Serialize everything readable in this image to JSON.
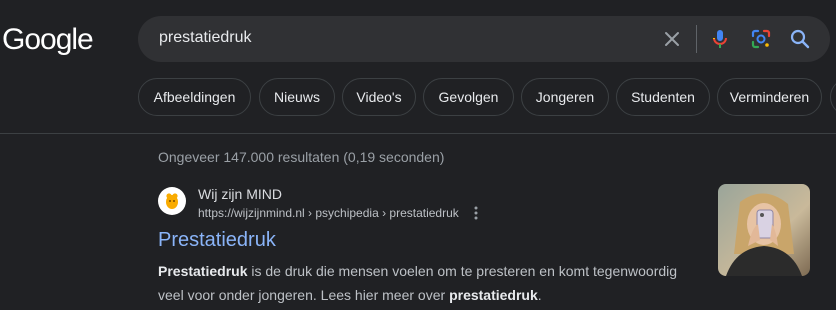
{
  "logo": {
    "text": "Google"
  },
  "search": {
    "query": "prestatiedruk"
  },
  "icons": {
    "clear": "close-icon",
    "voice": "microphone-icon",
    "lens": "camera-lens-icon",
    "search": "magnifier-icon"
  },
  "chips": [
    {
      "label": "Afbeeldingen"
    },
    {
      "label": "Nieuws"
    },
    {
      "label": "Video's"
    },
    {
      "label": "Gevolgen"
    },
    {
      "label": "Jongeren"
    },
    {
      "label": "Studenten"
    },
    {
      "label": "Verminderen"
    }
  ],
  "stats": "Ongeveer 147.000 resultaten (0,19 seconden)",
  "result": {
    "site_name": "Wij zijn MIND",
    "url": "https://wijzijnmind.nl › psychipedia › prestatiedruk",
    "title": "Prestatiedruk",
    "snippet": {
      "bold1": "Prestatiedruk",
      "text1": " is de druk die mensen voelen om te presteren en komt tegenwoordig veel voor onder jongeren. Lees hier meer over ",
      "bold2": "prestatiedruk",
      "text2": "."
    }
  },
  "colors": {
    "background": "#202124",
    "searchbar": "#303134",
    "link": "#8ab4f8",
    "favicon_accent": "#f9ab00"
  }
}
